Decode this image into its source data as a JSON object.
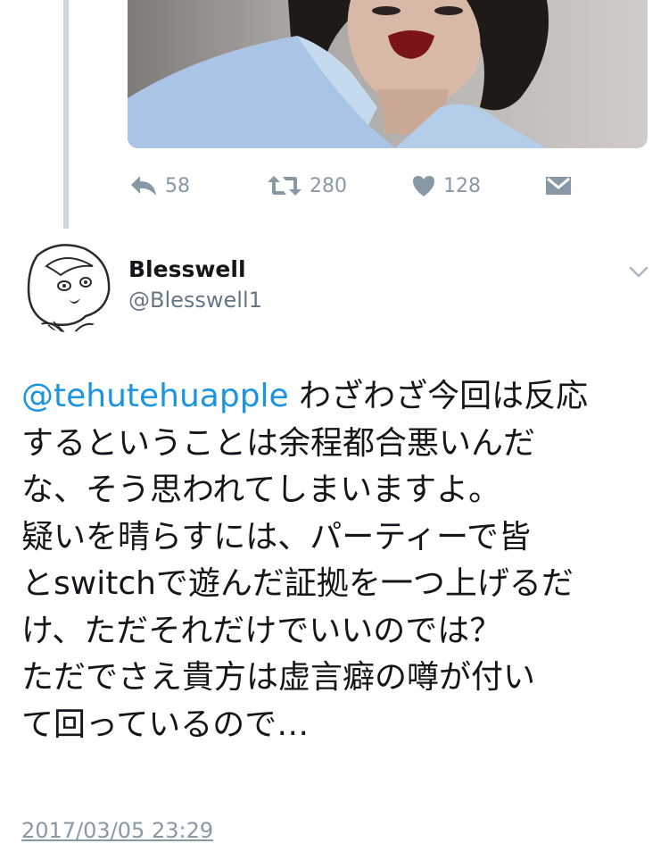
{
  "previous_tweet": {
    "actions": {
      "reply": {
        "icon": "reply-icon",
        "count": "58"
      },
      "retweet": {
        "icon": "retweet-icon",
        "count": "280"
      },
      "like": {
        "icon": "heart-icon",
        "count": "128"
      },
      "message": {
        "icon": "envelope-icon"
      }
    }
  },
  "tweet": {
    "author": {
      "display_name": "Blesswell",
      "handle": "@Blesswell1"
    },
    "menu_icon": "chevron-down-icon",
    "text": {
      "mention": "@tehutehuapple",
      "line1_rest": " わざわざ今回は反応",
      "line2": "するということは余程都合悪いんだ",
      "line3": "な、そう思われてしまいますよ。",
      "line4": "疑いを晴らすには、パーティーで皆",
      "line5": "とswitchで遊んだ証拠を一つ上げるだ",
      "line6": "け、ただそれだけでいいのでは？",
      "line7": "ただでさえ貴方は虚言癖の噂が付い",
      "line8": "て回っているので…"
    },
    "timestamp": "2017/03/05 23:29"
  },
  "colors": {
    "link": "#1b95e0",
    "secondary_text": "#8899a6",
    "handle": "#657786",
    "thread_line": "#c9d6e2"
  }
}
